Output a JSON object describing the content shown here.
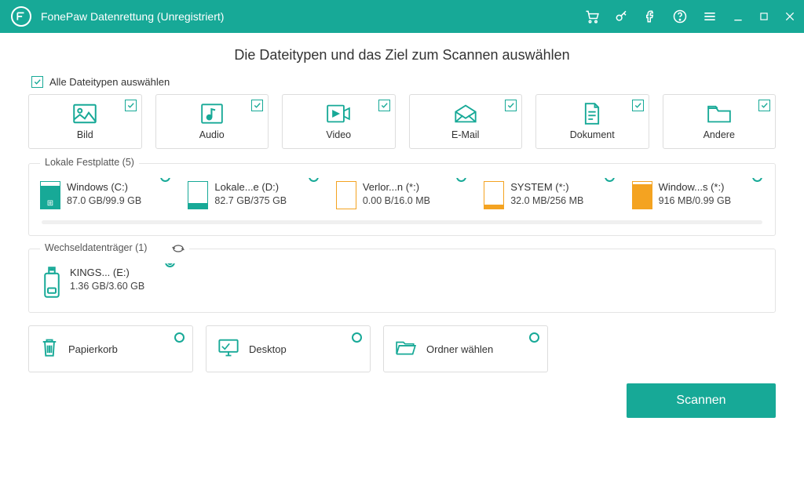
{
  "header": {
    "app_title": "FonePaw Datenrettung (Unregistriert)"
  },
  "page": {
    "title": "Die Dateitypen und das Ziel zum Scannen auswählen",
    "select_all_label": "Alle Dateitypen auswählen"
  },
  "types": {
    "items": [
      {
        "label": "Bild"
      },
      {
        "label": "Audio"
      },
      {
        "label": "Video"
      },
      {
        "label": "E-Mail"
      },
      {
        "label": "Dokument"
      },
      {
        "label": "Andere"
      }
    ]
  },
  "local": {
    "label": "Lokale Festplatte (5)",
    "drives": [
      {
        "name": "Windows (C:)",
        "size": "87.0 GB/99.9 GB"
      },
      {
        "name": "Lokale...e (D:)",
        "size": "82.7 GB/375 GB"
      },
      {
        "name": "Verlor...n (*:)",
        "size": "0.00  B/16.0 MB"
      },
      {
        "name": "SYSTEM (*:)",
        "size": "32.0 MB/256 MB"
      },
      {
        "name": "Window...s (*:)",
        "size": "916 MB/0.99 GB"
      }
    ]
  },
  "removable": {
    "label": "Wechseldatenträger (1)",
    "drives": [
      {
        "name": "KINGS... (E:)",
        "size": "1.36 GB/3.60 GB"
      }
    ]
  },
  "locations": {
    "items": [
      {
        "label": "Papierkorb"
      },
      {
        "label": "Desktop"
      },
      {
        "label": "Ordner wählen"
      }
    ]
  },
  "footer": {
    "scan_label": "Scannen"
  }
}
